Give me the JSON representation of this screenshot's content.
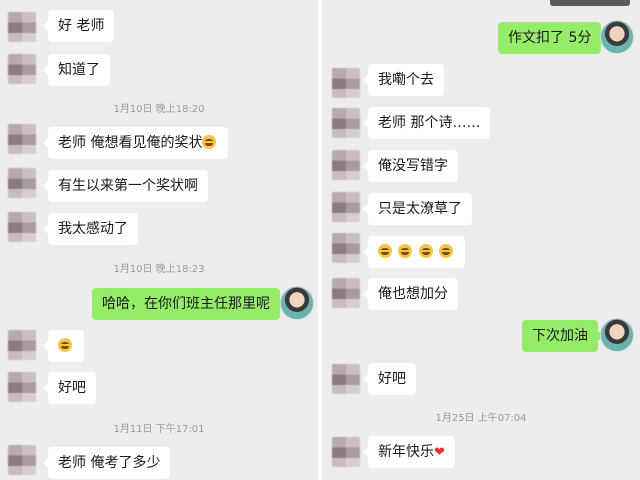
{
  "left": {
    "messages": [
      {
        "text": "好 老师"
      },
      {
        "text": "知道了"
      },
      {
        "text": "老师 俺想看见俺的奖状"
      },
      {
        "text": "有生以来第一个奖状啊"
      },
      {
        "text": "我太感动了"
      },
      {
        "text": "哈哈，在你们班主任那里呢"
      },
      {
        "text": "好吧"
      },
      {
        "text": "老师 俺考了多少"
      }
    ],
    "timestamps": [
      "1月10日 晚上18:20",
      "1月10日 晚上18:23",
      "1月11日 下午17:01"
    ]
  },
  "right": {
    "messages": [
      {
        "text": "作文扣了 5分"
      },
      {
        "text": "我嘞个去"
      },
      {
        "text": "老师 那个诗……"
      },
      {
        "text": "俺没写错字"
      },
      {
        "text": "只是太潦草了"
      },
      {
        "text": "俺也想加分"
      },
      {
        "text": "下次加油"
      },
      {
        "text": "好吧"
      },
      {
        "text": "新年快乐"
      }
    ],
    "timestamps": [
      "1月25日 上午07:04"
    ]
  },
  "icons": [
    "grin-sweat-emoji",
    "crying-emoji",
    "red-heart-emoji"
  ],
  "colors": {
    "background": "#ededed",
    "incoming_bubble": "#ffffff",
    "outgoing_bubble": "#95ec69",
    "timestamp": "#9a9a9a"
  }
}
